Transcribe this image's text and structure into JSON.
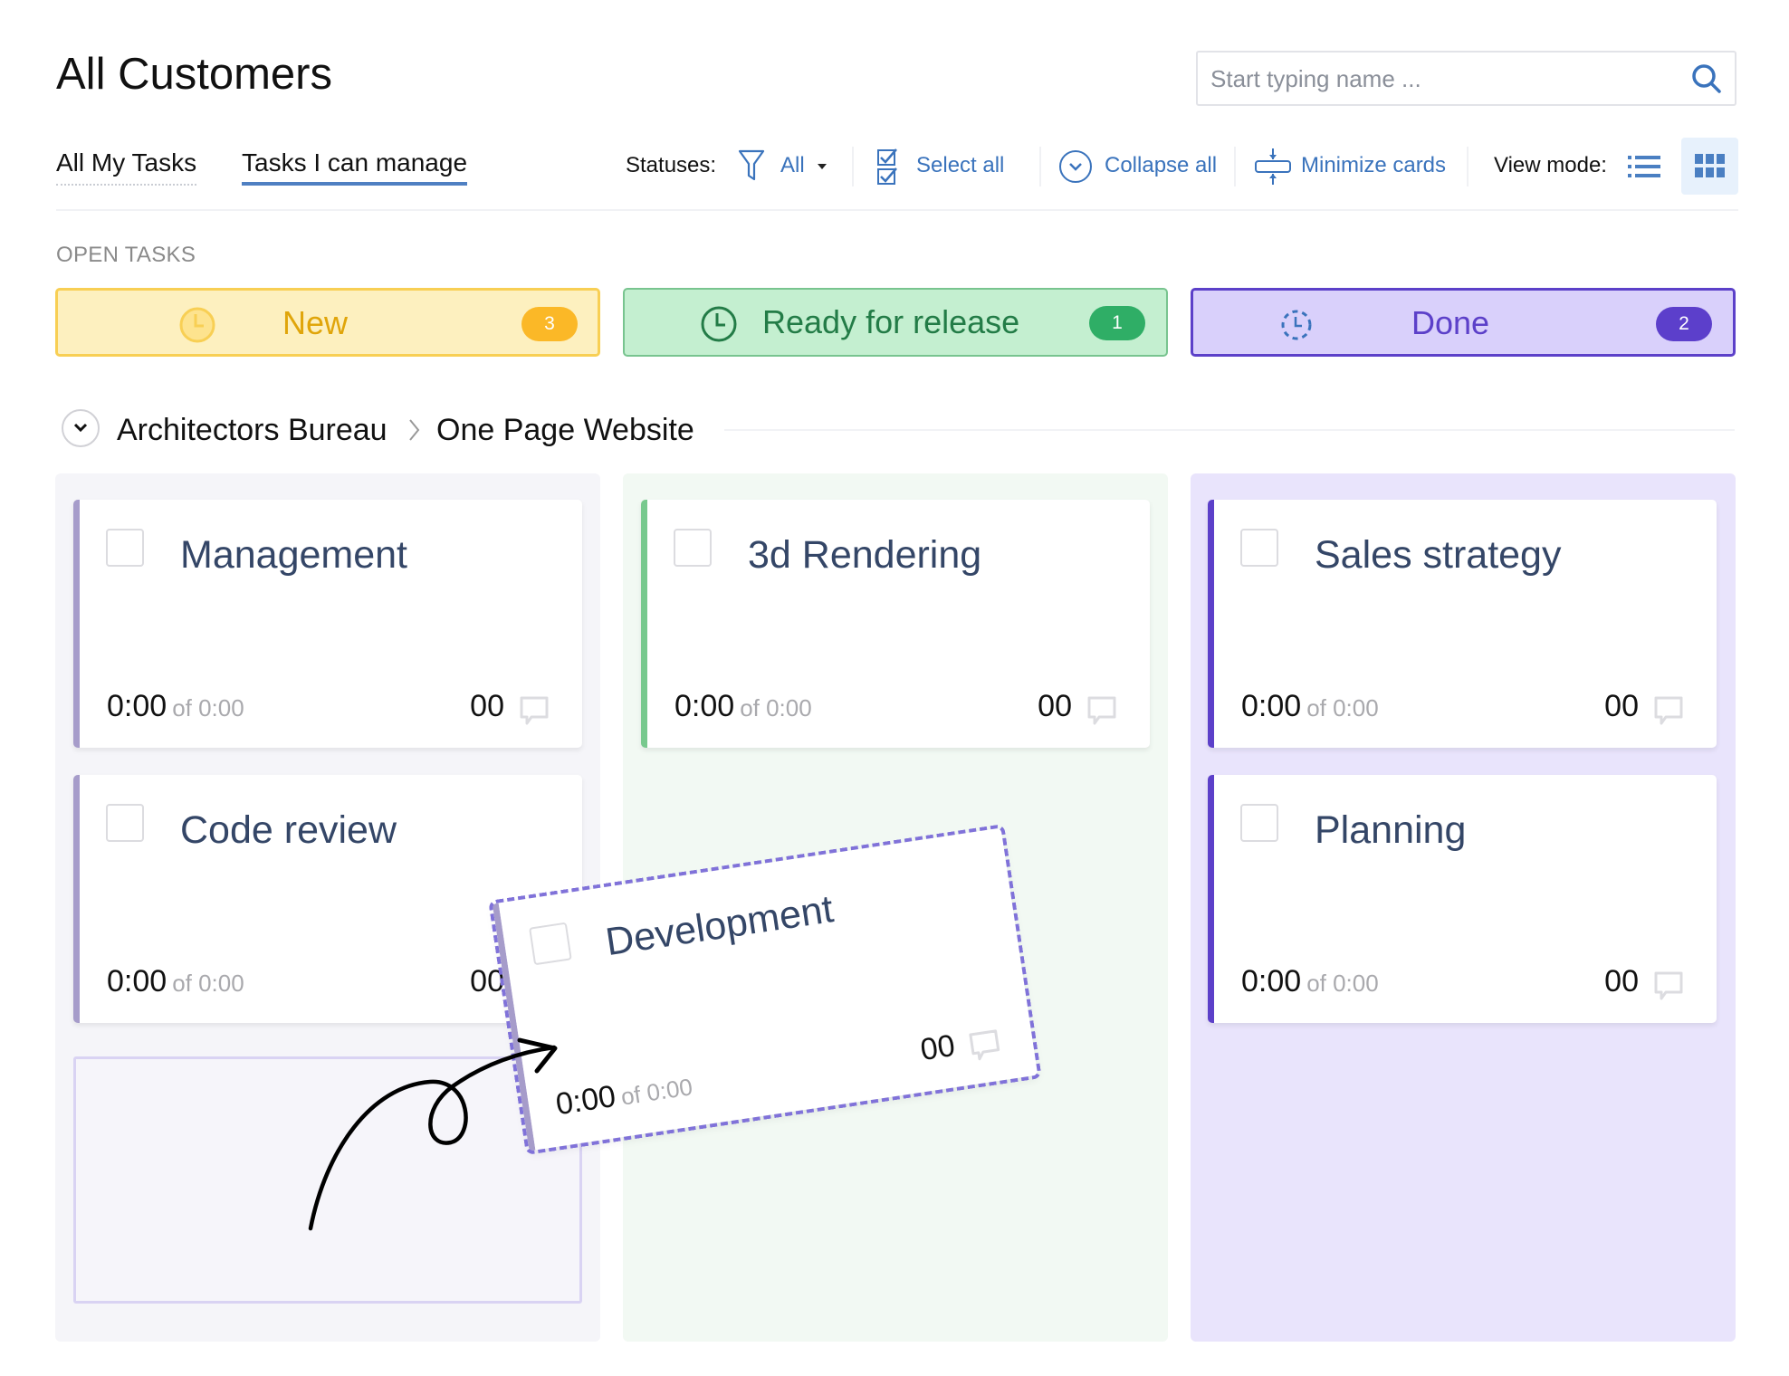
{
  "header": {
    "title": "All Customers",
    "search": {
      "placeholder": "Start typing name ...",
      "value": ""
    }
  },
  "tabs": [
    {
      "label": "All My Tasks",
      "active": false
    },
    {
      "label": "Tasks I can manage",
      "active": true
    }
  ],
  "toolbar": {
    "statuses_label": "Statuses:",
    "statuses_value": "All",
    "select_all": "Select all",
    "collapse_all": "Collapse all",
    "minimize_cards": "Minimize cards",
    "view_mode_label": "View mode:",
    "view_mode_selected": "grid"
  },
  "section_label": "OPEN TASKS",
  "statuses": [
    {
      "name": "New",
      "count": "3",
      "icon": "clock-icon",
      "color": "#fbb827"
    },
    {
      "name": "Ready for release",
      "count": "1",
      "icon": "clock-icon",
      "color": "#2fae66"
    },
    {
      "name": "Done",
      "count": "2",
      "icon": "dashed-clock-icon",
      "color": "#5c3fcb"
    }
  ],
  "breadcrumb": {
    "client": "Architectors Bureau",
    "project": "One Page Website"
  },
  "columns": {
    "new": [
      {
        "title": "Management",
        "time": "0:00",
        "estimate": "of 0:00",
        "comments": "00"
      },
      {
        "title": "Code review",
        "time": "0:00",
        "estimate": "of 0:00",
        "comments": "00"
      }
    ],
    "ready": [
      {
        "title": "3d Rendering",
        "time": "0:00",
        "estimate": "of 0:00",
        "comments": "00"
      }
    ],
    "done": [
      {
        "title": "Sales strategy",
        "time": "0:00",
        "estimate": "of 0:00",
        "comments": "00"
      },
      {
        "title": "Planning",
        "time": "0:00",
        "estimate": "of 0:00",
        "comments": "00"
      }
    ]
  },
  "dragging_card": {
    "title": "Development",
    "time": "0:00",
    "estimate": "of 0:00",
    "comments": "00"
  }
}
